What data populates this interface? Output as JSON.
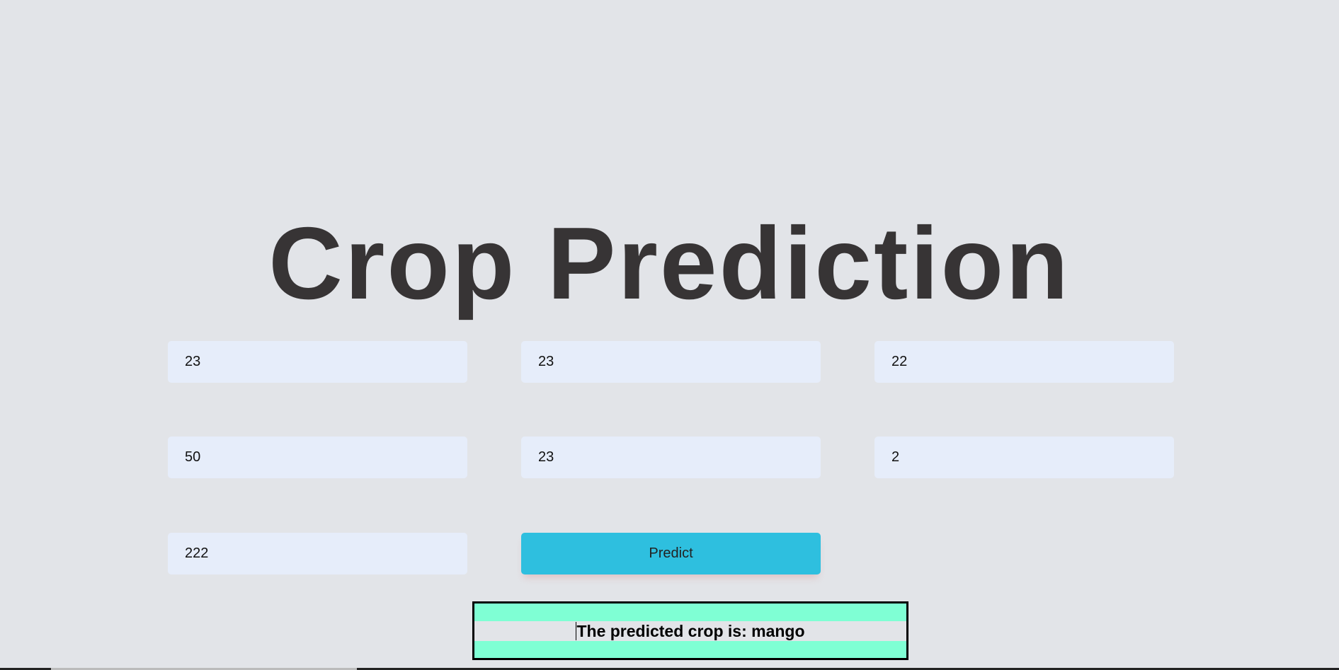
{
  "page": {
    "title": "Crop Prediction"
  },
  "form": {
    "fields": [
      {
        "value": "23"
      },
      {
        "value": "23"
      },
      {
        "value": "22"
      },
      {
        "value": "50"
      },
      {
        "value": "23"
      },
      {
        "value": "2"
      },
      {
        "value": "222"
      }
    ],
    "predict_label": "Predict"
  },
  "result": {
    "text": "The predicted crop is: mango"
  },
  "colors": {
    "background": "#e2e4e8",
    "input_bg": "#e6edfa",
    "button_bg": "#2ebfdf",
    "result_bg": "#7fffd4",
    "title_color": "#373435"
  }
}
